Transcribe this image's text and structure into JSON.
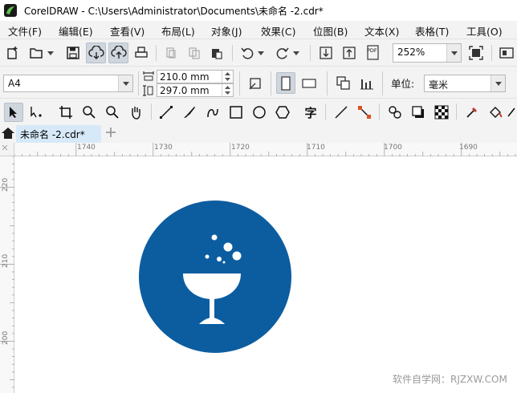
{
  "window": {
    "title": "CorelDRAW - C:\\Users\\Administrator\\Documents\\未命名 -2.cdr*"
  },
  "menu": [
    {
      "label": "文件(F)"
    },
    {
      "label": "编辑(E)"
    },
    {
      "label": "查看(V)"
    },
    {
      "label": "布局(L)"
    },
    {
      "label": "对象(J)"
    },
    {
      "label": "效果(C)"
    },
    {
      "label": "位图(B)"
    },
    {
      "label": "文本(X)"
    },
    {
      "label": "表格(T)"
    },
    {
      "label": "工具(O)"
    }
  ],
  "standard_toolbar": {
    "zoom_value": "252%",
    "pdf_label": "PDF"
  },
  "property_bar": {
    "page_size": "A4",
    "width": "210.0 mm",
    "height": "297.0 mm",
    "unit_label": "单位:",
    "unit_value": "毫米"
  },
  "toolbox": {
    "text_tool_glyph": "字"
  },
  "tabs": {
    "document": "未命名 -2.cdr*"
  },
  "ruler": {
    "horizontal": [
      "1740",
      "1730",
      "1720",
      "1710",
      "1700",
      "1690"
    ],
    "vertical": [
      "220",
      "210",
      "200"
    ]
  },
  "artwork": {
    "circle_color": "#0c5da0",
    "icon_color": "#ffffff"
  },
  "watermark": "软件自学网：RJZXW.COM"
}
